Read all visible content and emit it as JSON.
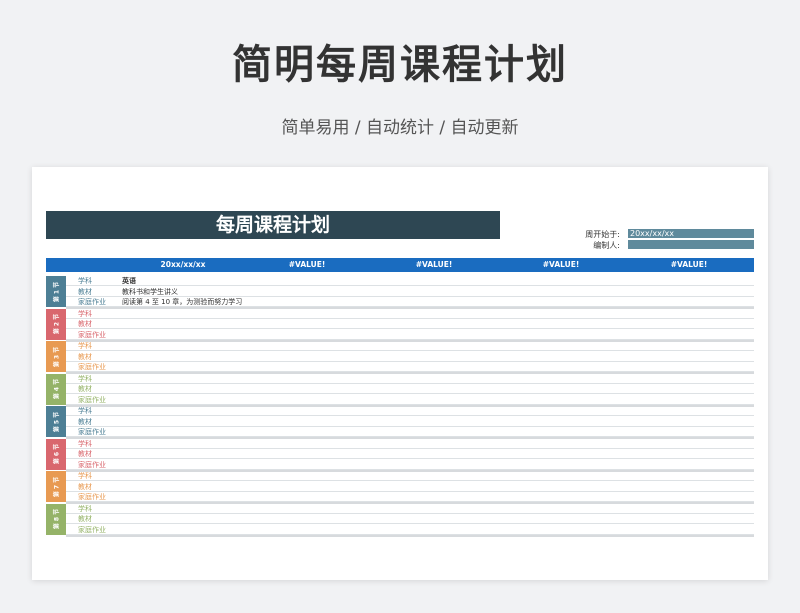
{
  "hero": {
    "title": "简明每周课程计划",
    "subtitle": "简单易用 / 自动统计 / 自动更新"
  },
  "sheet": {
    "banner_title": "每周课程计划",
    "meta": {
      "week_start_label": "周开始于:",
      "week_start_value": "20xx/xx/xx",
      "editor_label": "编制人:",
      "editor_value": ""
    },
    "header": [
      "20xx/xx/xx",
      "#VALUE!",
      "#VALUE!",
      "#VALUE!",
      "#VALUE!"
    ],
    "row_labels": {
      "subject": "学科",
      "material": "教材",
      "homework": "家庭作业"
    },
    "sections": [
      {
        "tag": "第 1 节",
        "color": "#4d7f95",
        "subject": "英语",
        "material": "教科书和学生讲义",
        "homework": "阅读第 4 至 10 章，为测验而努力学习"
      },
      {
        "tag": "第 2 节",
        "color": "#d9676e",
        "subject": "",
        "material": "",
        "homework": ""
      },
      {
        "tag": "第 3 节",
        "color": "#e89a52",
        "subject": "",
        "material": "",
        "homework": ""
      },
      {
        "tag": "第 4 节",
        "color": "#95b368",
        "subject": "",
        "material": "",
        "homework": ""
      },
      {
        "tag": "第 5 节",
        "color": "#4d7f95",
        "subject": "",
        "material": "",
        "homework": ""
      },
      {
        "tag": "第 6 节",
        "color": "#d9676e",
        "subject": "",
        "material": "",
        "homework": ""
      },
      {
        "tag": "第 7 节",
        "color": "#e89a52",
        "subject": "",
        "material": "",
        "homework": ""
      },
      {
        "tag": "第 8 节",
        "color": "#95b368",
        "subject": "",
        "material": "",
        "homework": ""
      }
    ]
  }
}
